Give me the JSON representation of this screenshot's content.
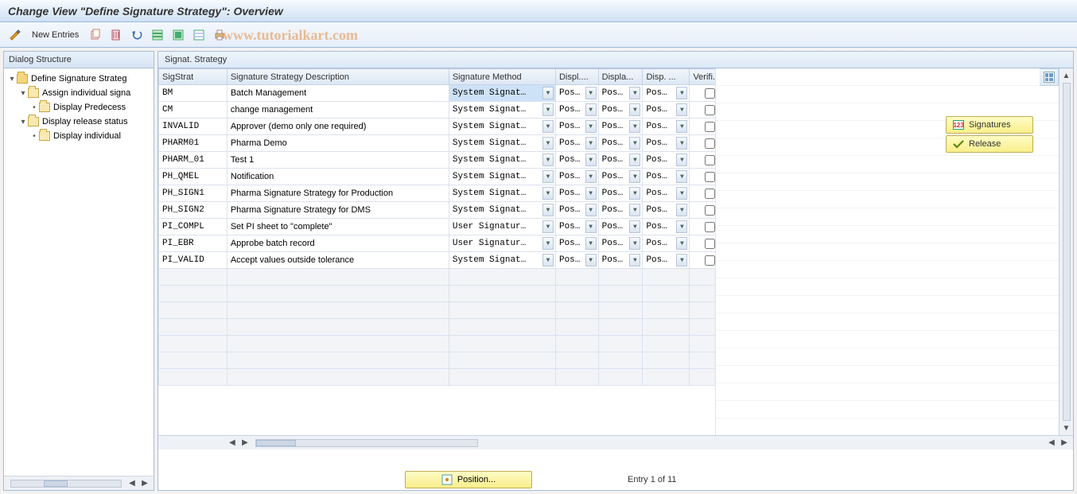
{
  "title": "Change View \"Define Signature Strategy\": Overview",
  "watermark": "www.tutorialkart.com",
  "toolbar": {
    "new_entries": "New Entries"
  },
  "tree": {
    "header": "Dialog Structure",
    "nodes": {
      "root": "Define Signature Strateg",
      "n1": "Assign individual signa",
      "n1a": "Display Predecess",
      "n2": "Display release status",
      "n2a": "Display individual "
    }
  },
  "table": {
    "title": "Signat. Strategy",
    "columns": {
      "c0": "SigStrat",
      "c1": "Signature Strategy Description",
      "c2": "Signature Method",
      "c3": "Displ....",
      "c4": "Displa...",
      "c5": "Disp. ...",
      "c6": "Verifi..."
    },
    "rows": [
      {
        "id": "BM",
        "desc": "Batch Management",
        "method": "System Signat…",
        "d1": "Pos…",
        "d2": "Pos…",
        "d3": "Pos…",
        "sel": true
      },
      {
        "id": "CM",
        "desc": "change management",
        "method": "System Signat…",
        "d1": "Pos…",
        "d2": "Pos…",
        "d3": "Pos…"
      },
      {
        "id": "INVALID",
        "desc": "Approver (demo only one required)",
        "method": "System Signat…",
        "d1": "Pos…",
        "d2": "Pos…",
        "d3": "Pos…"
      },
      {
        "id": "PHARM01",
        "desc": "Pharma Demo",
        "method": "System Signat…",
        "d1": "Pos…",
        "d2": "Pos…",
        "d3": "Pos…"
      },
      {
        "id": "PHARM_01",
        "desc": "Test 1",
        "method": "System Signat…",
        "d1": "Pos…",
        "d2": "Pos…",
        "d3": "Pos…"
      },
      {
        "id": "PH_QMEL",
        "desc": "Notification",
        "method": "System Signat…",
        "d1": "Pos…",
        "d2": "Pos…",
        "d3": "Pos…"
      },
      {
        "id": "PH_SIGN1",
        "desc": "Pharma Signature Strategy for Production",
        "method": "System Signat…",
        "d1": "Pos…",
        "d2": "Pos…",
        "d3": "Pos…"
      },
      {
        "id": "PH_SIGN2",
        "desc": "Pharma Signature Strategy for DMS",
        "method": "System Signat…",
        "d1": "Pos…",
        "d2": "Pos…",
        "d3": "Pos…"
      },
      {
        "id": "PI_COMPL",
        "desc": "Set PI sheet to \"complete\"",
        "method": "User Signatur…",
        "d1": "Pos…",
        "d2": "Pos…",
        "d3": "Pos…"
      },
      {
        "id": "PI_EBR",
        "desc": "Approbe batch record",
        "method": "User Signatur…",
        "d1": "Pos…",
        "d2": "Pos…",
        "d3": "Pos…"
      },
      {
        "id": "PI_VALID",
        "desc": "Accept values outside tolerance",
        "method": "System Signat…",
        "d1": "Pos…",
        "d2": "Pos…",
        "d3": "Pos…"
      }
    ]
  },
  "side": {
    "signatures": "Signatures",
    "release": "Release"
  },
  "footer": {
    "position": "Position...",
    "entry": "Entry 1 of 11"
  }
}
